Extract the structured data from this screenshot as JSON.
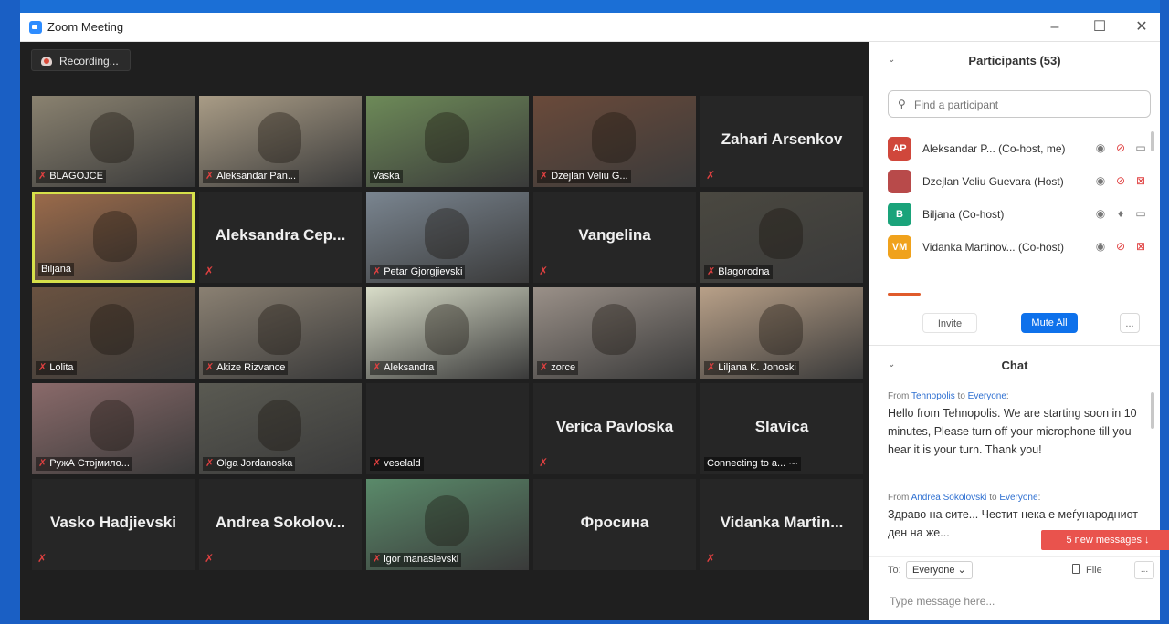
{
  "window": {
    "title": "Zoom Meeting",
    "minimize": "–",
    "maximize": "☐",
    "close": "✕"
  },
  "recording": {
    "label": "Recording..."
  },
  "tiles": [
    {
      "name": "BLAGOJCE",
      "big": "",
      "photo": true,
      "tone": "#8a8270",
      "active": false
    },
    {
      "name": "Aleksandar Pan...",
      "big": "",
      "photo": true,
      "tone": "#a99c86",
      "active": false
    },
    {
      "name": "Vaska",
      "big": "",
      "photo": true,
      "tone": "#6d8a58",
      "active": false,
      "nomic": true
    },
    {
      "name": "Dzejlan Veliu G...",
      "big": "",
      "photo": true,
      "tone": "#6a4a3a",
      "active": false
    },
    {
      "name": "",
      "big": "Zahari Arsenkov",
      "photo": false,
      "active": false
    },
    {
      "name": "Biljana",
      "big": "",
      "photo": true,
      "tone": "#9a6a4a",
      "active": true,
      "nomic": true
    },
    {
      "name": "",
      "big": "Aleksandra Cep...",
      "photo": false,
      "active": false
    },
    {
      "name": "Petar Gjorgjievski",
      "big": "",
      "photo": true,
      "tone": "#7a8590",
      "active": false
    },
    {
      "name": "",
      "big": "Vangelina",
      "photo": false,
      "active": false
    },
    {
      "name": "Blagorodna",
      "big": "",
      "photo": true,
      "tone": "#4a4840",
      "active": false
    },
    {
      "name": "Lolita",
      "big": "",
      "photo": true,
      "tone": "#6a5240",
      "active": false
    },
    {
      "name": "Akize Rizvance",
      "big": "",
      "photo": true,
      "tone": "#8a8072",
      "active": false
    },
    {
      "name": "Aleksandra",
      "big": "",
      "photo": true,
      "tone": "#d8dcc8",
      "active": false
    },
    {
      "name": "zorce",
      "big": "",
      "photo": true,
      "tone": "#9a9088",
      "active": false
    },
    {
      "name": "Liljana K. Jonoski",
      "big": "",
      "photo": true,
      "tone": "#b8a088",
      "active": false
    },
    {
      "name": "РужА Стојмило...",
      "big": "",
      "photo": true,
      "tone": "#8a6a6a",
      "active": false
    },
    {
      "name": "Olga Jordanoska",
      "big": "",
      "photo": true,
      "tone": "#5a5a52",
      "active": false
    },
    {
      "name": "veselald",
      "big": "",
      "photo": false,
      "active": false
    },
    {
      "name": "",
      "big": "Verica Pavloska",
      "photo": false,
      "active": false
    },
    {
      "name": "Connecting to a... ·-·",
      "big": "Slavica",
      "photo": false,
      "active": false,
      "nomic": true
    },
    {
      "name": "",
      "big": "Vasko Hadjievski",
      "photo": false,
      "active": false
    },
    {
      "name": "",
      "big": "Andrea Sokolov...",
      "photo": false,
      "active": false
    },
    {
      "name": "igor manasievski",
      "big": "",
      "photo": true,
      "tone": "#5a8a6a",
      "active": false
    },
    {
      "name": "",
      "big": "Фросина",
      "photo": false,
      "active": false,
      "nomic": true
    },
    {
      "name": "",
      "big": "Vidanka Martin...",
      "photo": false,
      "active": false
    }
  ],
  "participants": {
    "title": "Participants (53)",
    "search_placeholder": "Find a participant",
    "list": [
      {
        "initials": "AP",
        "color": "#d0473b",
        "name": "Aleksandar P... (Co-host, me)",
        "mic": "off",
        "cam": "on"
      },
      {
        "initials": "",
        "color": "#b84a4a",
        "name": "Dzejlan Veliu Guevara (Host)",
        "mic": "off",
        "cam": "off"
      },
      {
        "initials": "B",
        "color": "#1aa37a",
        "name": "Biljana (Co-host)",
        "mic": "on",
        "cam": "on"
      },
      {
        "initials": "VM",
        "color": "#f0a21c",
        "name": "Vidanka Martinov... (Co-host)",
        "mic": "off",
        "cam": "off"
      }
    ],
    "invite": "Invite",
    "mute_all": "Mute All",
    "more": "..."
  },
  "chat": {
    "title": "Chat",
    "messages": [
      {
        "from": "Tehnopolis",
        "to": "Everyone",
        "text": "Hello from Tehnopolis. We are starting soon in 10 minutes, Please turn off your microphone till you hear it is your turn. Thank you!"
      },
      {
        "from": "Andrea Sokolovski",
        "to": "Everyone",
        "text": "Здраво на сите... Честит нека е меѓународниот ден на же..."
      }
    ],
    "from_word": "From",
    "to_word": "to",
    "new_messages": "5 new messages ↓",
    "to_label": "To:",
    "to_value": "Everyone ⌄",
    "file": "File",
    "more": "...",
    "input_placeholder": "Type message here..."
  }
}
